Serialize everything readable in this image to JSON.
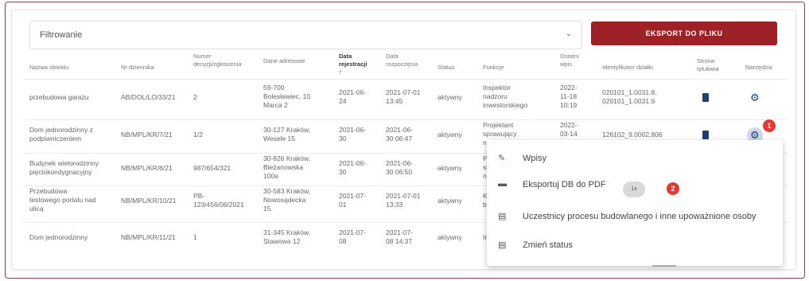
{
  "filter": {
    "label": "Filtrowanie",
    "chevron": "⌄"
  },
  "export_button": "EKSPORT DO PLIKU",
  "headers": {
    "nazwa": "Nazwa obiektu",
    "nr": "Nr dziennika",
    "numer1": "Numer",
    "numer2": "decyzji/zgłoszenia",
    "dane": "Dane adresowe",
    "datarej1": "Data",
    "datarej2": "rejestracji",
    "datarej_arrow": "↑",
    "datarozp1": "Data",
    "datarozp2": "rozpoczęcia",
    "status": "Status",
    "funkcje": "Funkcje",
    "ostatni1": "Ostatni",
    "ostatni2": "wpis",
    "ident": "Identyfikator działki",
    "strona1": "Strona",
    "strona2": "tytułowa",
    "narzedzia": "Narzędzia"
  },
  "rows": [
    {
      "nazwa": [
        "przebudowa garażu"
      ],
      "nr": "AB/DOL/LO/33/21",
      "numer": [
        "2"
      ],
      "adres": [
        "59-700",
        "Bolesławiec, 10",
        "Marca 2"
      ],
      "rej": [
        "2021-06-",
        "24"
      ],
      "rozp": [
        "2021-07-01",
        "13:45"
      ],
      "status": "aktywny",
      "funkcje": [
        "Inspektor",
        "nadzoru",
        "inwestorskiego"
      ],
      "ostatni": [
        "2022-",
        "11-18",
        "10:19"
      ],
      "ident": [
        "020101_1.0031.8,",
        "020101_1.0031.9"
      ]
    },
    {
      "nazwa": [
        "Dom jednorodzinny z",
        "podpiwniczeniem"
      ],
      "nr": "NB/MPL/KR/7/21",
      "numer": [
        "1/2"
      ],
      "adres": [
        "30-127 Kraków,",
        "Wesele 15"
      ],
      "rej": [
        "2021-06-",
        "30"
      ],
      "rozp": [
        "2021-06-",
        "30 06:47"
      ],
      "status": "aktywny",
      "funkcje": [
        "Projektant",
        "sprawujący",
        "nadzór autorski"
      ],
      "ostatni": [
        "2022-",
        "03-14",
        "07:06"
      ],
      "ident": [
        "126102_9.0002.806"
      ]
    },
    {
      "nazwa": [
        "Budynek wielorodzinny",
        "pięciokondygnacyjny"
      ],
      "nr": "NB/MPL/KR/8/21",
      "numer": [
        "987/654/321"
      ],
      "adres": [
        "30-826 Kraków,",
        "Bieżanowska",
        "100a"
      ],
      "rej": [
        "2021-06-",
        "30"
      ],
      "rozp": [
        "2021-06-",
        "30 06:50"
      ],
      "status": "aktywny",
      "funkcje": [
        "P",
        "sp",
        "n"
      ],
      "ostatni": [],
      "ident": []
    },
    {
      "nazwa": [
        "Przebudowa",
        "testowego portalu nad",
        "ulicą"
      ],
      "nr": "NB/MPL/KR/10/21",
      "numer": [
        "PB-",
        "123/456/06/2021"
      ],
      "adres": [
        "30-583 Kraków,",
        "Nowosądecka",
        "15"
      ],
      "rej": [
        "2021-07-",
        "01"
      ],
      "rozp": [
        "2021-07-01",
        "13:33"
      ],
      "status": "aktywny",
      "funkcje": [
        "K",
        "b"
      ],
      "ostatni": [],
      "ident": []
    },
    {
      "nazwa": [
        "Dom jednorodzinny"
      ],
      "nr": "NB/MPL/KR/11/21",
      "numer": [
        "1"
      ],
      "adres": [
        "31-345 Kraków,",
        "Stawowa 12"
      ],
      "rej": [
        "2021-07-",
        "08"
      ],
      "rozp": [
        "2021-07-",
        "08 14:37"
      ],
      "status": "aktywny",
      "funkcje": [
        "In"
      ],
      "ostatni": [],
      "ident": []
    }
  ],
  "badges": {
    "b1": "1",
    "b2": "2"
  },
  "cursor_label": "1x",
  "menu": [
    {
      "label": "Wpisy",
      "icon": "pencil-icon",
      "glyph": "✎"
    },
    {
      "label": "Eksportuj DB do PDF",
      "icon": "pdf-icon",
      "glyph": "▬"
    },
    {
      "label": "Uczestnicy procesu budowlanego i inne upoważnione osoby",
      "icon": "document-icon",
      "glyph": "▤"
    },
    {
      "label": "Zmień status",
      "icon": "document-icon",
      "glyph": "▤"
    }
  ],
  "colors": {
    "accent": "#9e2127",
    "icon": "#1e3f73",
    "highlight": "#eaf26b",
    "badge": "#e53935",
    "frame": "#8e3a56"
  }
}
